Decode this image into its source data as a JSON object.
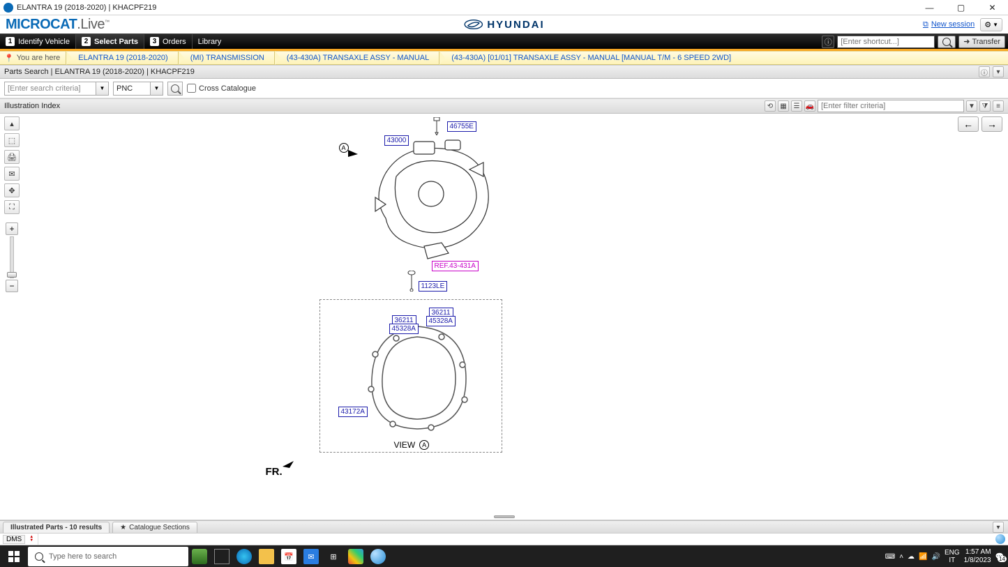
{
  "window": {
    "title": "ELANTRA 19 (2018-2020) | KHACPF219"
  },
  "header": {
    "logo1": "MICROCAT",
    "logo2": ".Live",
    "tm": "™",
    "brand": "HYUNDAI",
    "new_session": "New session"
  },
  "nav": {
    "steps": [
      {
        "num": "1",
        "label": "Identify Vehicle"
      },
      {
        "num": "2",
        "label": "Select Parts"
      },
      {
        "num": "3",
        "label": "Orders"
      }
    ],
    "library": "Library",
    "shortcut_placeholder": "[Enter shortcut...]",
    "transfer": "Transfer"
  },
  "breadcrumb": {
    "you_are_here": "You are here",
    "items": [
      "ELANTRA 19 (2018-2020)",
      "(MI) TRANSMISSION",
      "(43-430A) TRANSAXLE ASSY - MANUAL",
      "(43-430A) [01/01] TRANSAXLE ASSY - MANUAL [MANUAL T/M - 6 SPEED 2WD]"
    ]
  },
  "parts_search_header": "Parts Search | ELANTRA 19 (2018-2020) | KHACPF219",
  "search_row": {
    "criteria_placeholder": "[Enter search criteria]",
    "pnc_label": "PNC",
    "cross_catalogue": "Cross Catalogue"
  },
  "illus_header": {
    "title": "Illustration Index",
    "filter_placeholder": "[Enter filter criteria]"
  },
  "callouts": {
    "c46755E": "46755E",
    "c43000": "43000",
    "ref43431A": "REF.43-431A",
    "c1123LE": "1123LE",
    "c36211a": "36211",
    "c45328Aa": "45328A",
    "c36211b": "36211",
    "c45328Ab": "45328A",
    "c43172A": "43172A",
    "view": "VIEW",
    "fr": "FR."
  },
  "bottom_tabs": {
    "tab1": "Illustrated Parts - 10 results",
    "tab2": "Catalogue Sections"
  },
  "dms": {
    "label": "DMS"
  },
  "taskbar": {
    "search_placeholder": "Type here to search",
    "lang1": "ENG",
    "lang2": "IT",
    "time": "1:57 AM",
    "date": "1/8/2023",
    "badge": "14"
  }
}
